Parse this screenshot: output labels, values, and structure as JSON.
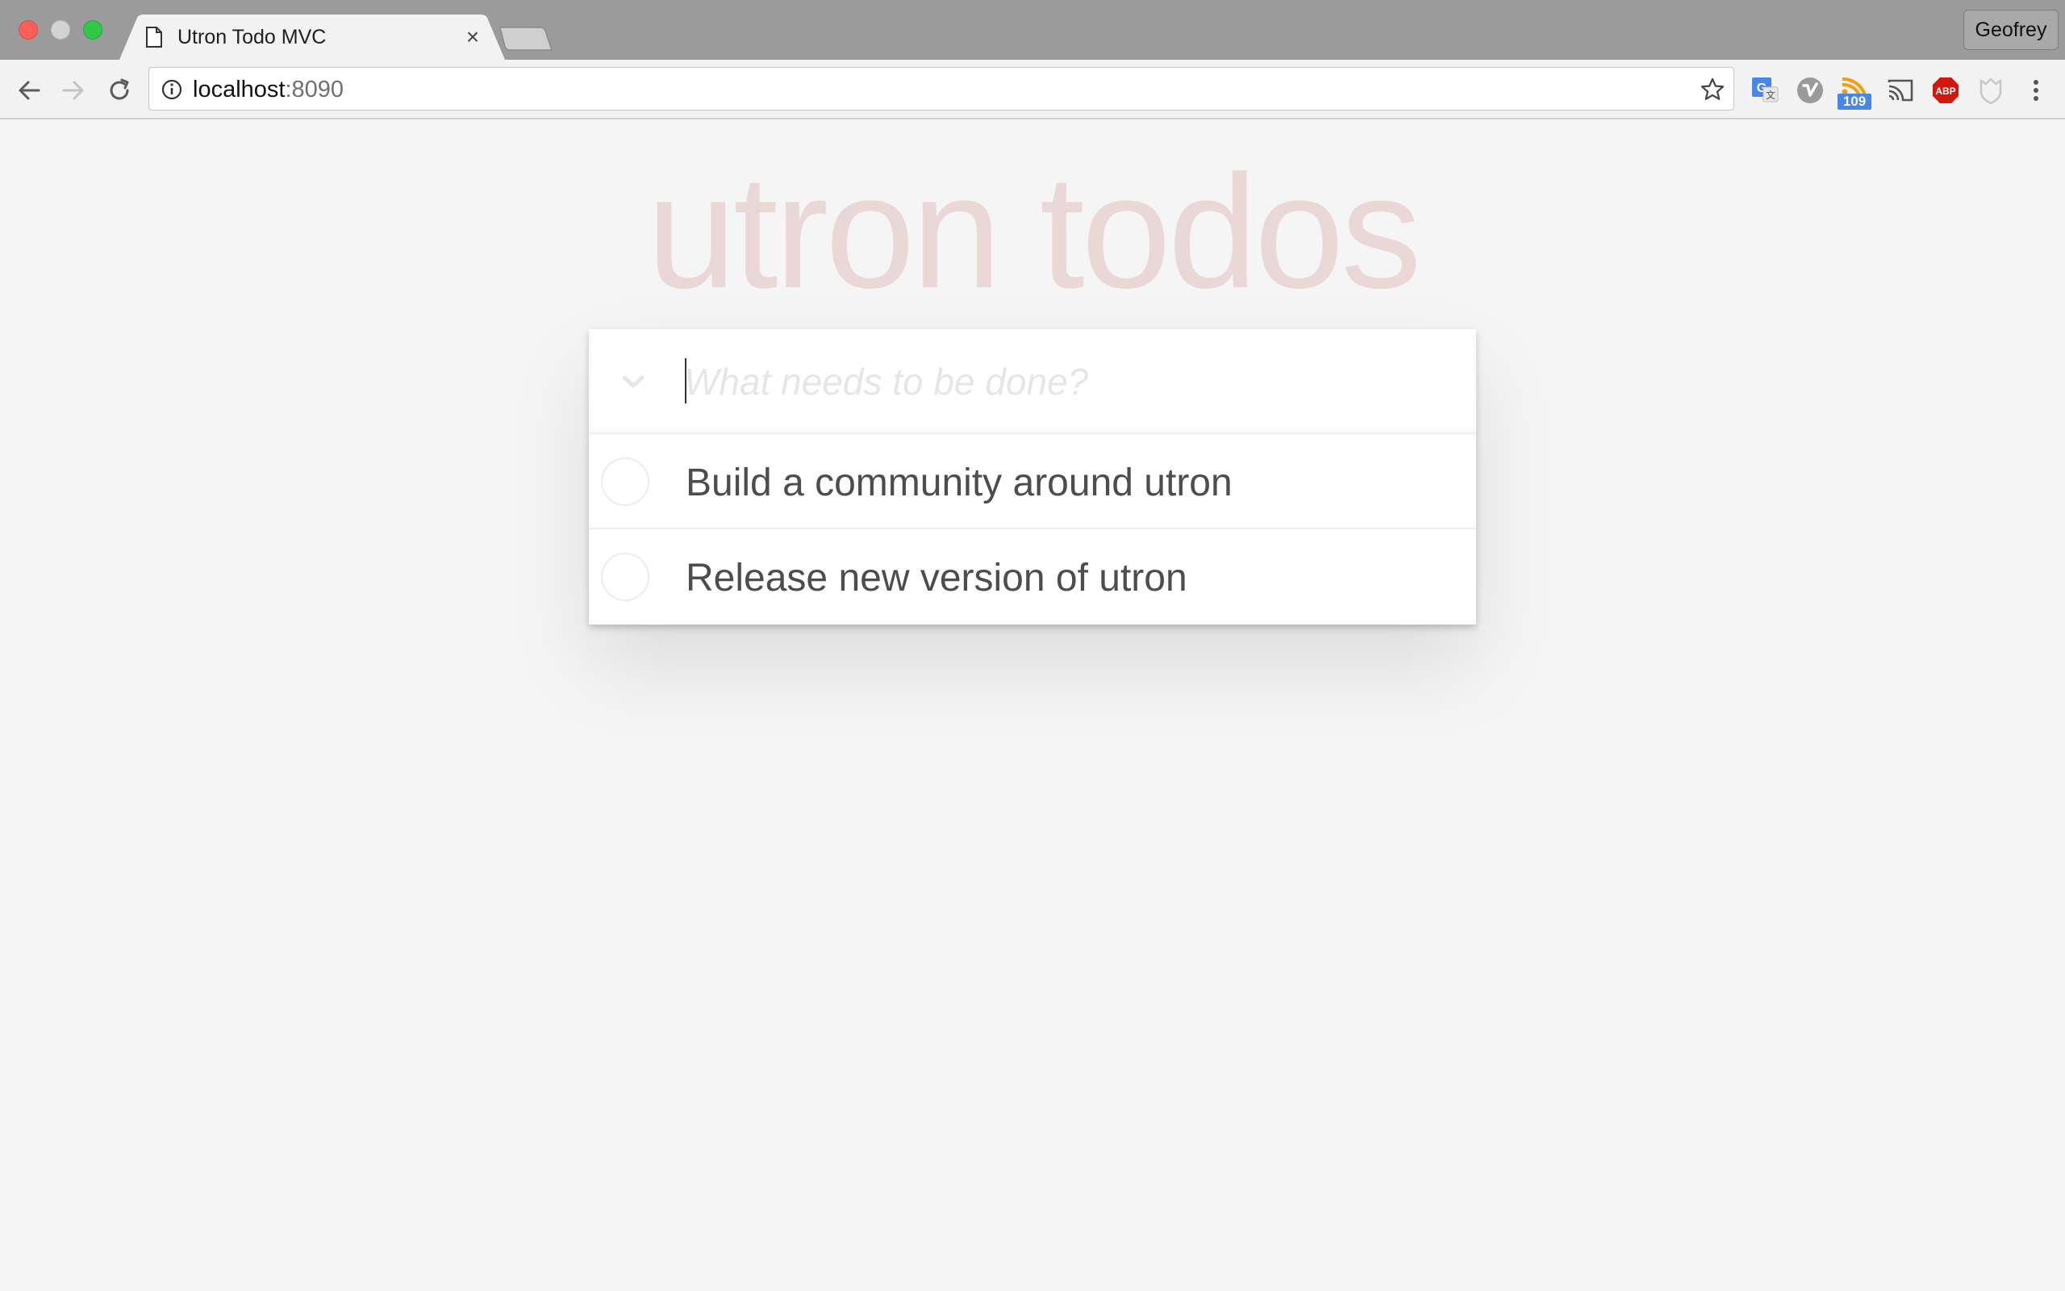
{
  "browser": {
    "tab": {
      "title": "Utron Todo MVC"
    },
    "profile_name": "Geofrey",
    "address": {
      "host": "localhost",
      "port": ":8090"
    },
    "extensions": {
      "rss_badge": "109",
      "adblock_label": "ABP"
    },
    "colors": {
      "translate": "#4a86e8",
      "rss": "#f39c12",
      "adblock": "#d2180c"
    }
  },
  "app": {
    "title": "utron todos",
    "new_todo_placeholder": "What needs to be done?",
    "new_todo_value": "",
    "todos": [
      {
        "title": "Build a community around utron",
        "completed": false
      },
      {
        "title": "Release new version of utron",
        "completed": false
      }
    ]
  }
}
